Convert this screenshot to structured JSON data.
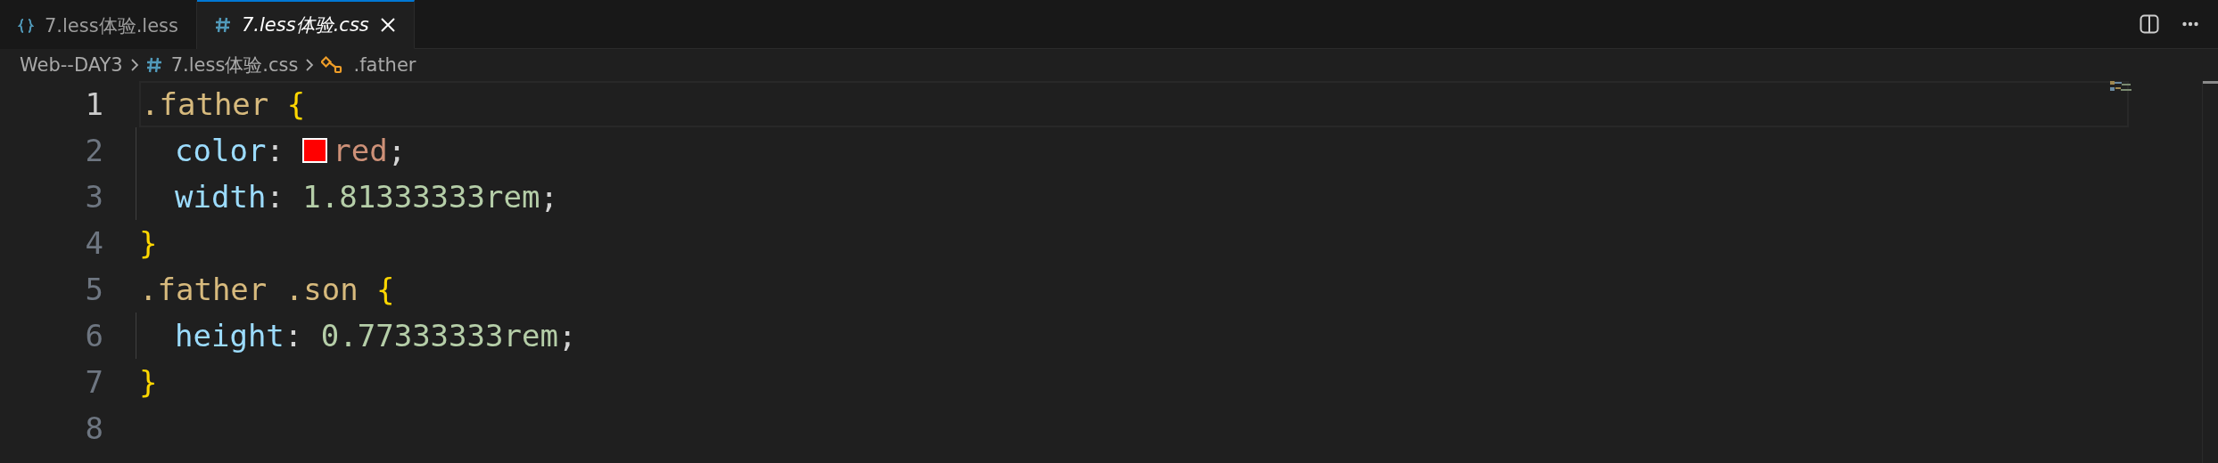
{
  "tabs": [
    {
      "kind": "less",
      "label": "7.less体验.less",
      "selected": false,
      "preview": false
    },
    {
      "kind": "css",
      "label": "7.less体验.css",
      "selected": true,
      "preview": true
    }
  ],
  "breadcrumb": [
    {
      "kind": "folder",
      "label": "Web--DAY3"
    },
    {
      "kind": "css",
      "label": "7.less体验.css"
    },
    {
      "kind": "symbol",
      "label": ".father"
    }
  ],
  "lines": [
    {
      "number": "1",
      "current": true,
      "indented": false,
      "tokens": [
        {
          "kind": "selector",
          "text": ".father "
        },
        {
          "kind": "brace",
          "text": "{"
        }
      ]
    },
    {
      "number": "2",
      "current": false,
      "indented": true,
      "tokens": [
        {
          "kind": "property",
          "text": "color"
        },
        {
          "kind": "punct",
          "text": ": "
        },
        {
          "kind": "swatch",
          "color": "#ff0000"
        },
        {
          "kind": "string",
          "text": "red"
        },
        {
          "kind": "punct",
          "text": ";"
        }
      ]
    },
    {
      "number": "3",
      "current": false,
      "indented": true,
      "tokens": [
        {
          "kind": "property",
          "text": "width"
        },
        {
          "kind": "punct",
          "text": ": "
        },
        {
          "kind": "number",
          "text": "1.81333333rem"
        },
        {
          "kind": "punct",
          "text": ";"
        }
      ]
    },
    {
      "number": "4",
      "current": false,
      "indented": false,
      "tokens": [
        {
          "kind": "brace",
          "text": "}"
        }
      ]
    },
    {
      "number": "5",
      "current": false,
      "indented": false,
      "tokens": [
        {
          "kind": "selector",
          "text": ".father .son "
        },
        {
          "kind": "brace",
          "text": "{"
        }
      ]
    },
    {
      "number": "6",
      "current": false,
      "indented": true,
      "tokens": [
        {
          "kind": "property",
          "text": "height"
        },
        {
          "kind": "punct",
          "text": ": "
        },
        {
          "kind": "number",
          "text": "0.77333333rem"
        },
        {
          "kind": "punct",
          "text": ";"
        }
      ]
    },
    {
      "number": "7",
      "current": false,
      "indented": false,
      "tokens": [
        {
          "kind": "brace",
          "text": "}"
        }
      ]
    },
    {
      "number": "8",
      "current": false,
      "indented": false
    }
  ]
}
